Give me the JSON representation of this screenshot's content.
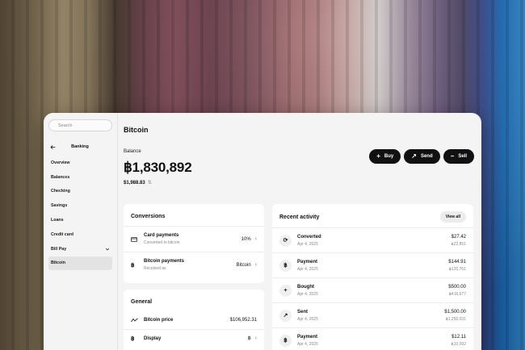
{
  "colors": {
    "accent": "#111111",
    "panel": "#f4f4f4",
    "card": "#ffffff"
  },
  "sidebar": {
    "search_placeholder": "Search",
    "section_title": "Banking",
    "items": [
      {
        "label": "Overview"
      },
      {
        "label": "Balances"
      },
      {
        "label": "Checking"
      },
      {
        "label": "Savings"
      },
      {
        "label": "Loans"
      },
      {
        "label": "Credit card"
      },
      {
        "label": "Bill Pay"
      },
      {
        "label": "Bitcoin"
      }
    ]
  },
  "header": {
    "title": "Bitcoin"
  },
  "balance": {
    "label": "Balance",
    "value": "฿1,830,892",
    "sub_value": "$1,988.83",
    "swap_icon": "swap-vertical-icon"
  },
  "actions": {
    "buy": "Buy",
    "send": "Send",
    "sell": "Sell"
  },
  "conversions": {
    "title": "Conversions",
    "rows": [
      {
        "title": "Card payments",
        "subtitle": "Converted to bitcoin",
        "value": "10%",
        "icon": "card-icon"
      },
      {
        "title": "Bitcoin payments",
        "subtitle": "Received as",
        "value": "Bitcoin",
        "icon": "bitcoin-icon"
      }
    ]
  },
  "general": {
    "title": "General",
    "rows": [
      {
        "title": "Bitcoin price",
        "value": "$106,952.31",
        "icon": "chart-line-icon"
      },
      {
        "title": "Display",
        "value": "฿",
        "icon": "bitcoin-icon"
      }
    ]
  },
  "activity": {
    "title": "Recent activity",
    "view_all": "View all",
    "items": [
      {
        "title": "Converted",
        "date": "Apr 4, 2025",
        "amount": "$27.42",
        "sub_amount": "฿22,851",
        "icon": "refresh-icon"
      },
      {
        "title": "Payment",
        "date": "Apr 4, 2025",
        "amount": "$144.91",
        "sub_amount": "฿120,761",
        "icon": "bitcoin-icon"
      },
      {
        "title": "Bought",
        "date": "Apr 4, 2025",
        "amount": "$500.00",
        "sub_amount": "฿416,677",
        "icon": "plus-icon"
      },
      {
        "title": "Sent",
        "date": "Apr 4, 2025",
        "amount": "$1,500.00",
        "sub_amount": "฿1,250,031",
        "icon": "arrow-up-right-icon"
      },
      {
        "title": "Payment",
        "date": "Apr 4, 2025",
        "amount": "$12.11",
        "sub_amount": "฿10,092",
        "icon": "bitcoin-icon"
      }
    ]
  }
}
